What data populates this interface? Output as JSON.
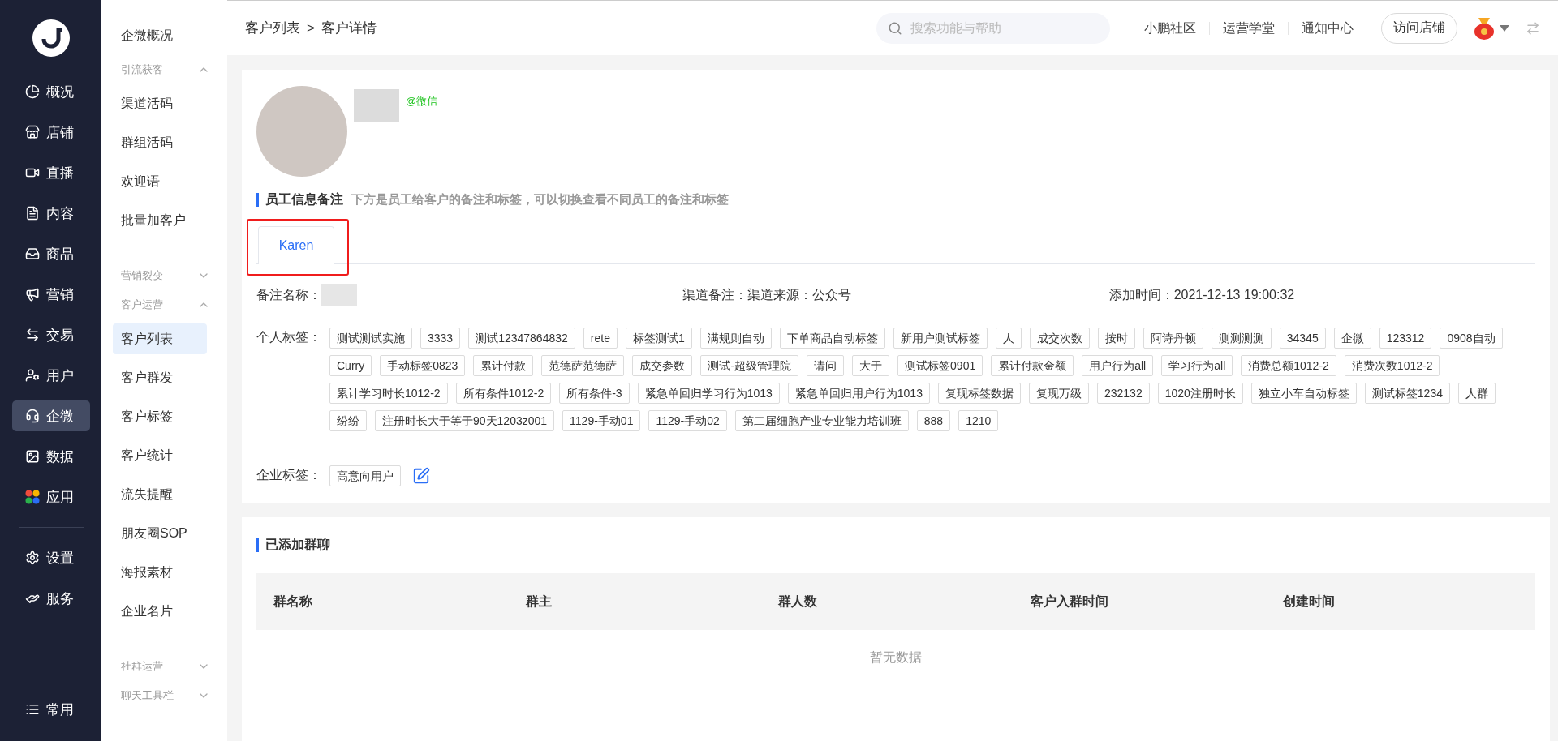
{
  "rail": {
    "items": [
      {
        "label": "概况",
        "selected": false
      },
      {
        "label": "店铺",
        "selected": false
      },
      {
        "label": "直播",
        "selected": false
      },
      {
        "label": "内容",
        "selected": false
      },
      {
        "label": "商品",
        "selected": false
      },
      {
        "label": "营销",
        "selected": false
      },
      {
        "label": "交易",
        "selected": false
      },
      {
        "label": "用户",
        "selected": false
      },
      {
        "label": "企微",
        "selected": true
      },
      {
        "label": "数据",
        "selected": false
      },
      {
        "label": "应用",
        "selected": false
      }
    ],
    "lower_items": [
      {
        "label": "设置",
        "selected": false
      },
      {
        "label": "服务",
        "selected": false
      }
    ],
    "footer": {
      "label": "常用"
    }
  },
  "submenu": [
    {
      "kind": "item",
      "label": "企微概况",
      "selected": false
    },
    {
      "kind": "group",
      "label": "引流获客",
      "expanded": true,
      "children": [
        {
          "label": "渠道活码",
          "selected": false
        },
        {
          "label": "群组活码",
          "selected": false
        },
        {
          "label": "欢迎语",
          "selected": false
        },
        {
          "label": "批量加客户",
          "selected": false
        }
      ]
    },
    {
      "kind": "group",
      "label": "营销裂变",
      "expanded": false
    },
    {
      "kind": "group",
      "label": "客户运营",
      "expanded": true,
      "children": [
        {
          "label": "客户列表",
          "selected": true
        },
        {
          "label": "客户群发",
          "selected": false
        },
        {
          "label": "客户标签",
          "selected": false
        },
        {
          "label": "客户统计",
          "selected": false
        },
        {
          "label": "流失提醒",
          "selected": false
        },
        {
          "label": "朋友圈SOP",
          "selected": false
        },
        {
          "label": "海报素材",
          "selected": false
        },
        {
          "label": "企业名片",
          "selected": false
        }
      ]
    },
    {
      "kind": "group",
      "label": "社群运营",
      "expanded": false
    },
    {
      "kind": "group",
      "label": "聊天工具栏",
      "expanded": false
    }
  ],
  "topbar": {
    "breadcrumb": [
      "客户列表",
      "客户详情"
    ],
    "separator": ">",
    "search": {
      "placeholder": "搜索功能与帮助"
    },
    "links": [
      "小鹏社区",
      "运营学堂",
      "通知中心"
    ],
    "button": "访问店铺"
  },
  "customer": {
    "source": "@微信"
  },
  "staff_notes": {
    "title": "员工信息备注",
    "hint": "下方是员工给客户的备注和标签，可以切换查看不同员工的备注和标签",
    "tabs": [
      {
        "label": "Karen",
        "selected": true
      }
    ],
    "fields": [
      {
        "label": "备注名称：",
        "kind": "hidden"
      },
      {
        "label": "渠道备注：",
        "kind": "text",
        "value": "渠道来源：公众号"
      },
      {
        "label": "添加时间：",
        "kind": "text",
        "value": "2021-12-13 19:00:32"
      }
    ],
    "personal_tags": {
      "label": "个人标签：",
      "tags": [
        "测试测试实施",
        "3333",
        "测试12347864832",
        "rete",
        "标签测试1",
        "满规则自动",
        "下单商品自动标签",
        "新用户测试标签",
        "人",
        "成交次数",
        "按时",
        "阿诗丹顿",
        "测测测测",
        "34345",
        "企微",
        "123312",
        "0908自动",
        "Curry",
        "手动标签0823",
        "累计付款",
        "范德萨范德萨",
        "成交参数",
        "测试-超级管理院",
        "请问",
        "大于",
        "测试标签0901",
        "累计付款金额",
        "用户行为all",
        "学习行为all",
        "消费总额1012-2",
        "消费次数1012-2",
        "累计学习时长1012-2",
        "所有条件1012-2",
        "所有条件-3",
        "紧急单回归学习行为1013",
        "紧急单回归用户行为1013",
        "复现标签数据",
        "复现万级",
        "232132",
        "1020注册时长",
        "独立小车自动标签",
        "测试标签1234",
        "人群",
        "纷纷",
        "注册时长大于等于90天1203z001",
        "1129-手动01",
        "1129-手动02",
        "第二届细胞产业专业能力培训班",
        "888",
        "1210"
      ]
    },
    "company_tags": {
      "label": "企业标签：",
      "tags": [
        "高意向用户"
      ]
    }
  },
  "group_chats": {
    "title": "已添加群聊",
    "columns": [
      "群名称",
      "群主",
      "群人数",
      "客户入群时间",
      "创建时间"
    ],
    "empty": "暂无数据"
  }
}
